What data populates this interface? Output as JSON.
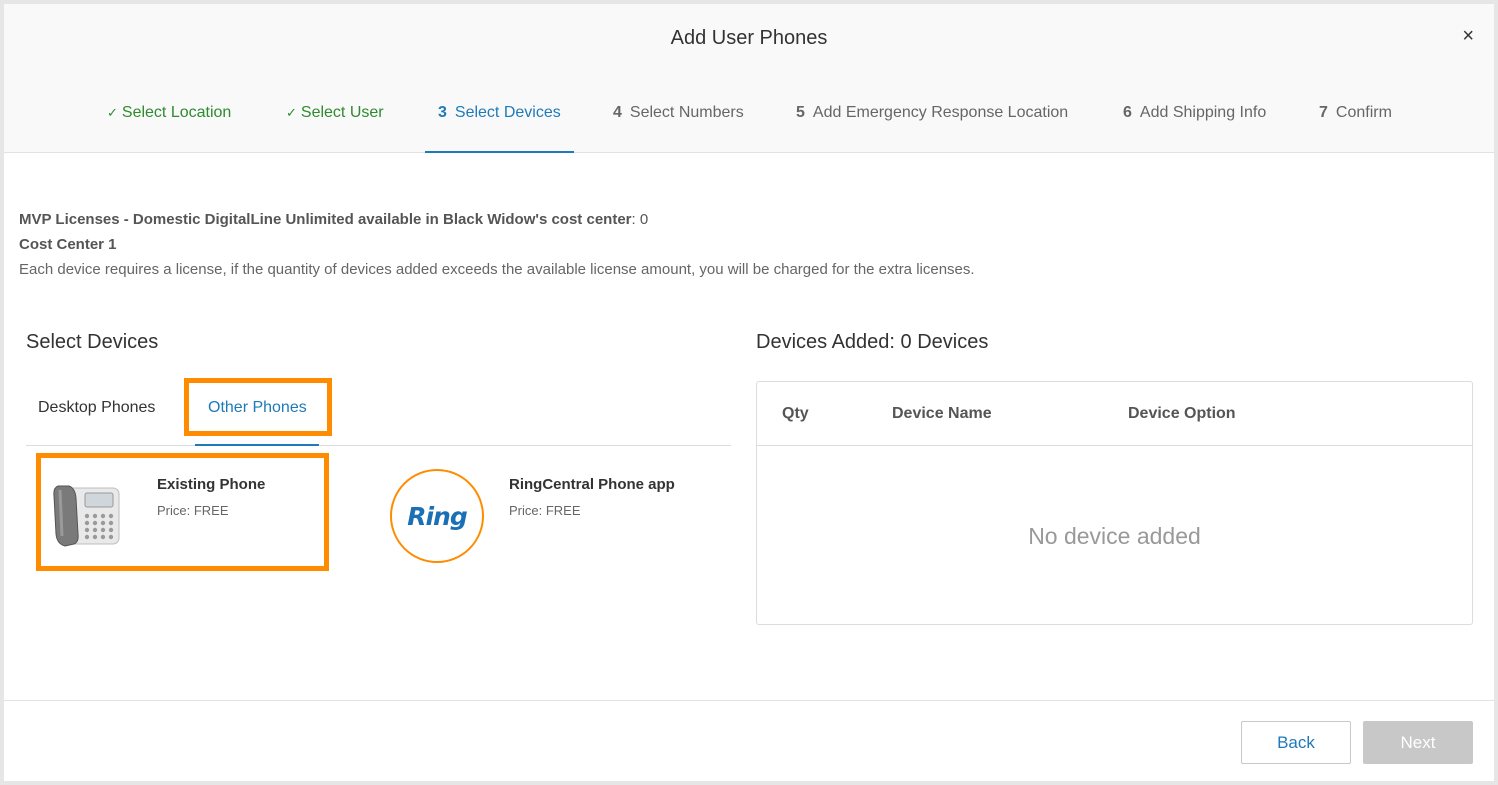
{
  "modal": {
    "title": "Add User Phones",
    "close_glyph": "×"
  },
  "stepper": {
    "steps": [
      {
        "num": "✓",
        "label": "Select Location",
        "state": "done"
      },
      {
        "num": "✓",
        "label": "Select User",
        "state": "done"
      },
      {
        "num": "3",
        "label": "Select Devices",
        "state": "active"
      },
      {
        "num": "4",
        "label": "Select Numbers",
        "state": "pending"
      },
      {
        "num": "5",
        "label": "Add Emergency Response Location",
        "state": "pending"
      },
      {
        "num": "6",
        "label": "Add Shipping Info",
        "state": "pending"
      },
      {
        "num": "7",
        "label": "Confirm",
        "state": "pending"
      }
    ]
  },
  "license": {
    "headline": "MVP Licenses - Domestic DigitalLine Unlimited available in Black Widow's cost center",
    "count": ": 0",
    "cost_center": "Cost Center 1",
    "note": "Each device requires a license, if the quantity of devices added exceeds the available license amount, you will be charged for the extra licenses."
  },
  "select_devices": {
    "title": "Select Devices",
    "tabs": [
      {
        "label": "Desktop Phones",
        "active": false
      },
      {
        "label": "Other Phones",
        "active": true
      }
    ],
    "devices": [
      {
        "name": "Existing Phone",
        "price": "Price: FREE",
        "icon": "desk-phone-icon"
      },
      {
        "name": "RingCentral Phone app",
        "price": "Price: FREE",
        "icon": "ring-logo",
        "logo_text": "Ring"
      }
    ]
  },
  "devices_added": {
    "title": "Devices Added: 0 Devices",
    "columns": [
      "Qty",
      "Device Name",
      "Device Option"
    ],
    "empty_message": "No device added"
  },
  "footer": {
    "back_label": "Back",
    "next_label": "Next"
  },
  "colors": {
    "accent": "#1e7ab8",
    "done": "#2e8b2e",
    "highlight": "#ff8c00",
    "disabled": "#c8c8c8"
  }
}
